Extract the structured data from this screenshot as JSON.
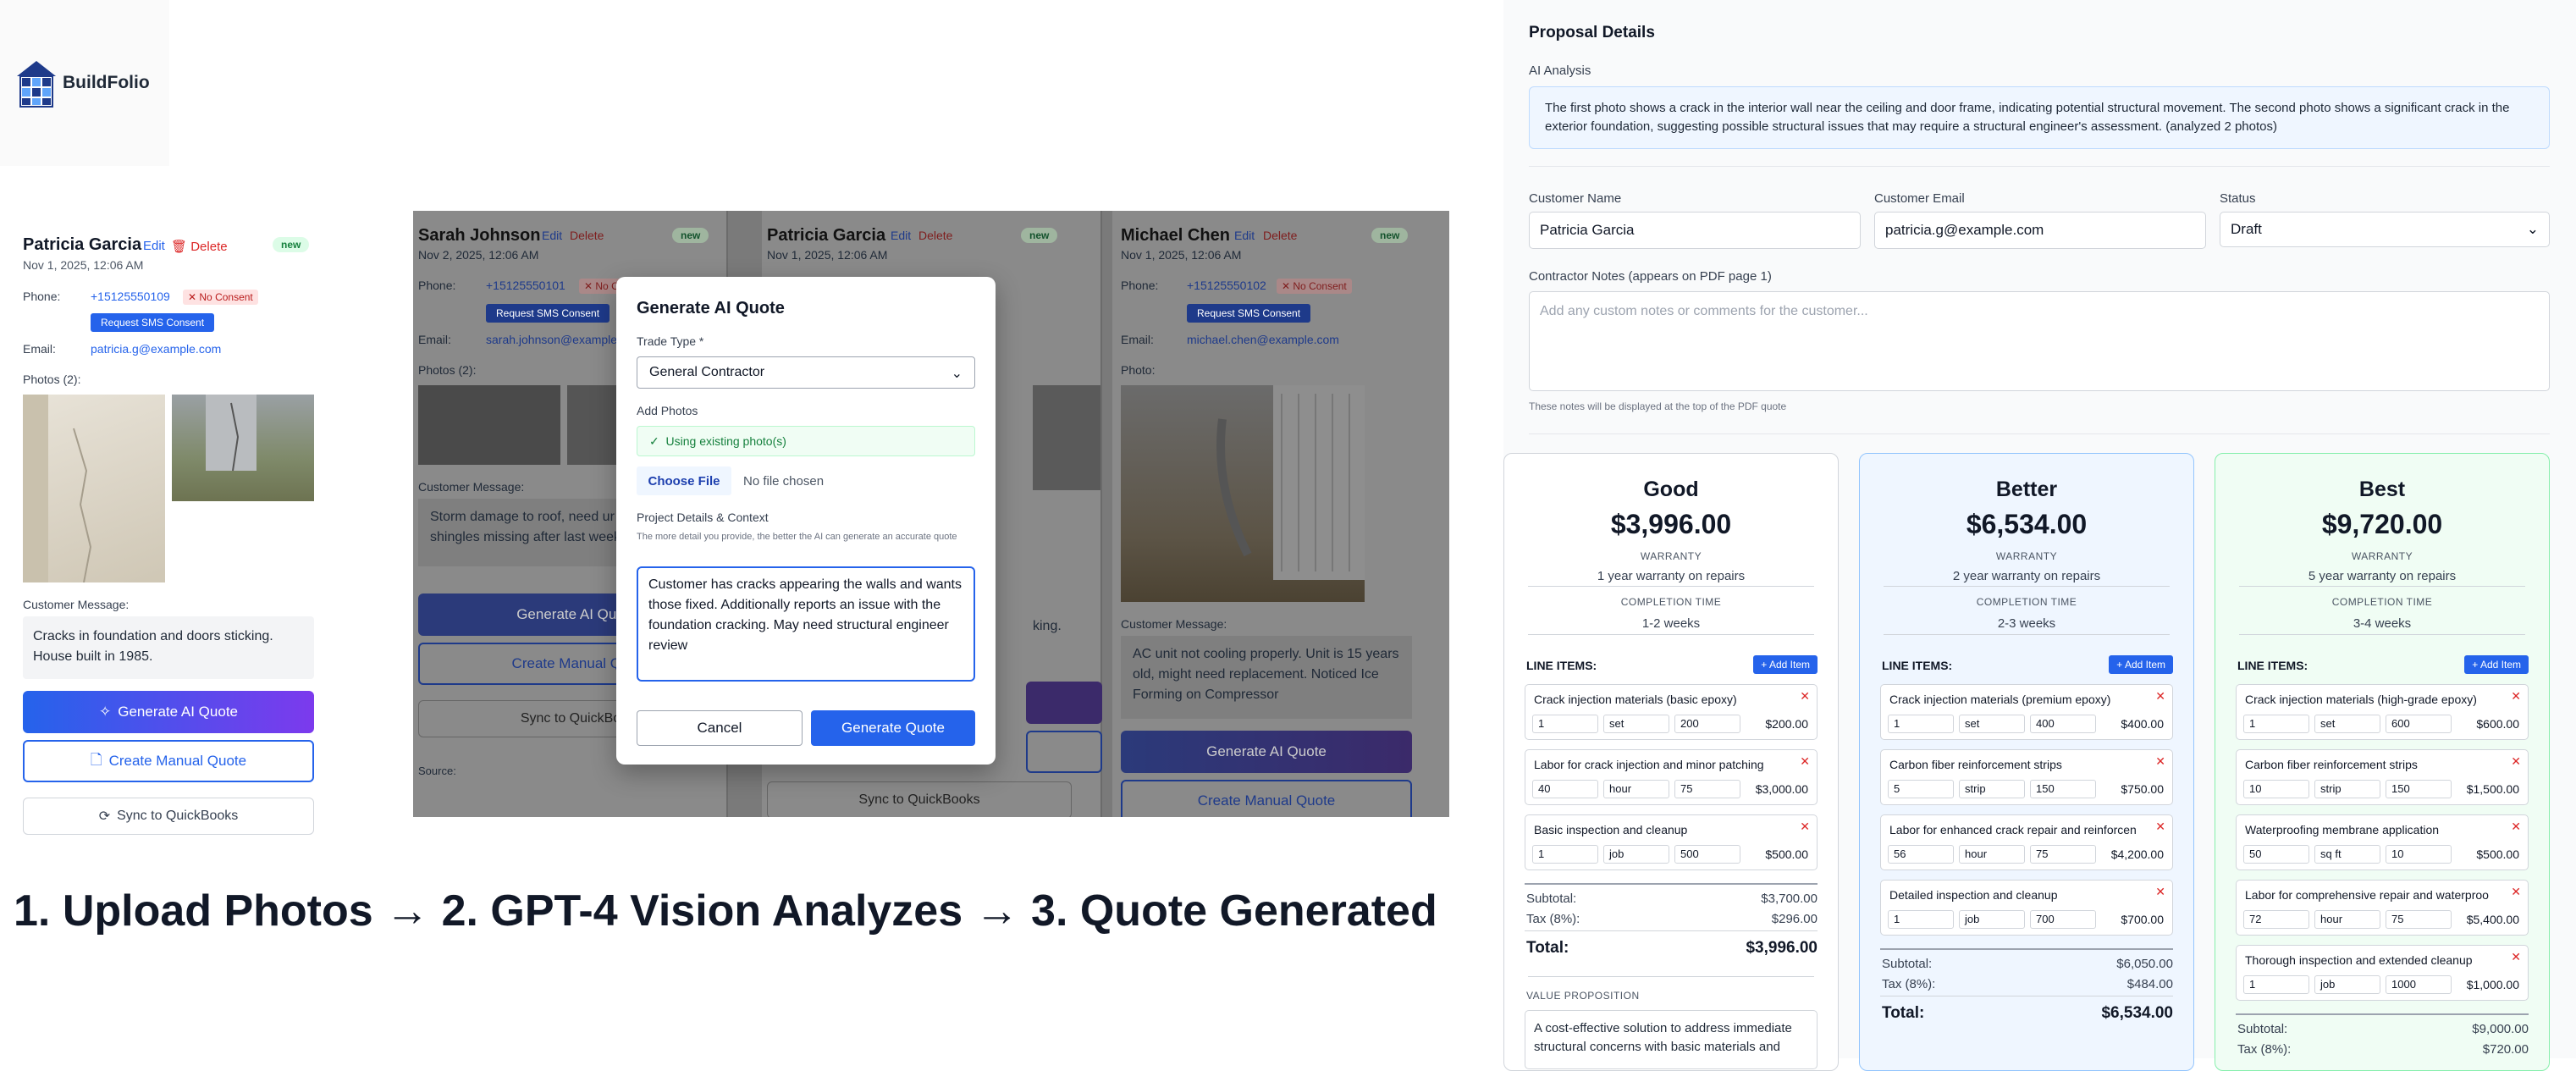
{
  "brand": {
    "name": "BuildFolio"
  },
  "caption": "1. Upload Photos → 2. GPT-4 Vision Analyzes → 3. Quote Generated",
  "lead_left": {
    "name": "Patricia Garcia",
    "edit": "Edit",
    "delete": "Delete",
    "badge": "new",
    "date": "Nov 1, 2025, 12:06 AM",
    "phone_label": "Phone:",
    "phone": "+15125550109",
    "no_consent": "✕ No Consent",
    "sms_button": "Request SMS Consent",
    "email_label": "Email:",
    "email": "patricia.g@example.com",
    "photos_label": "Photos (2):",
    "message_label": "Customer Message:",
    "message": "Cracks in foundation and doors sticking. House built in 1985.",
    "ai_button": "Generate AI Quote",
    "manual_button": "Create Manual Quote",
    "qb_button": "Sync to QuickBooks"
  },
  "bg_leads": [
    {
      "name": "Sarah Johnson",
      "edit": "Edit",
      "delete": "Delete",
      "badge": "new",
      "date": "Nov 2, 2025, 12:06 AM",
      "phone_label": "Phone:",
      "phone": "+15125550101",
      "no_consent": "✕ No C",
      "sms": "Request SMS Consent",
      "email_label": "Email:",
      "email": "sarah.johnson@example",
      "photos_label": "Photos (2):",
      "message_label": "Customer Message:",
      "message": "Storm damage to roof, need ur Multiple shingles missing after last week.",
      "ai": "Generate AI Quo",
      "manual": "Create Manual Qu",
      "qb": "Sync to QuickBo",
      "source": "Source:"
    },
    {
      "name": "Patricia Garcia",
      "edit": "Edit",
      "delete": "Delete",
      "badge": "new",
      "date": "Nov 1, 2025, 12:06 AM",
      "message_tail": "king.",
      "qb": "Sync to QuickBooks"
    },
    {
      "name": "Michael Chen",
      "edit": "Edit",
      "delete": "Delete",
      "badge": "new",
      "date": "Nov 1, 2025, 12:06 AM",
      "phone_label": "Phone:",
      "phone": "+15125550102",
      "no_consent": "✕ No Consent",
      "sms": "Request SMS Consent",
      "email_label": "Email:",
      "email": "michael.chen@example.com",
      "photo_label": "Photo:",
      "message_label": "Customer Message:",
      "message": "AC unit not cooling properly. Unit is 15 years old, might need replacement. Noticed Ice Forming on Compressor",
      "ai": "Generate AI Quote",
      "manual": "Create Manual Quote"
    }
  ],
  "modal": {
    "title": "Generate AI Quote",
    "trade_label": "Trade Type *",
    "trade_value": "General Contractor",
    "photos_label": "Add Photos",
    "photos_status": "Using existing photo(s)",
    "choose_file": "Choose File",
    "no_file": "No file chosen",
    "details_label": "Project Details & Context",
    "details_help": "The more detail you provide, the better the AI can generate an accurate quote",
    "details_value": "Customer has cracks appearing the walls and wants those fixed. Additionally reports an issue with the foundation cracking. May need structural engineer review",
    "cancel": "Cancel",
    "submit": "Generate Quote"
  },
  "proposal": {
    "title": "Proposal Details",
    "ai_label": "AI Analysis",
    "ai_text": "The first photo shows a crack in the interior wall near the ceiling and door frame, indicating potential structural movement. The second photo shows a significant crack in the exterior foundation, suggesting possible structural issues that may require a structural engineer's assessment. (analyzed 2 photos)",
    "customer_name_label": "Customer Name",
    "customer_name": "Patricia Garcia",
    "customer_email_label": "Customer Email",
    "customer_email": "patricia.g@example.com",
    "status_label": "Status",
    "status": "Draft",
    "notes_label": "Contractor Notes (appears on PDF page 1)",
    "notes_placeholder": "Add any custom notes or comments for the customer...",
    "notes_help": "These notes will be displayed at the top of the PDF quote"
  },
  "common": {
    "warranty": "WARRANTY",
    "completion": "COMPLETION TIME",
    "line_items": "LINE ITEMS:",
    "add_item": "+ Add Item",
    "subtotal": "Subtotal:",
    "tax": "Tax (8%):",
    "total": "Total:",
    "value_prop": "VALUE PROPOSITION"
  },
  "tiers": [
    {
      "name": "Good",
      "price": "$3,996.00",
      "warranty": "1 year warranty on repairs",
      "completion": "1-2 weeks",
      "items": [
        {
          "name": "Crack injection materials (basic epoxy)",
          "qty": "1",
          "unit": "set",
          "rate": "200",
          "amount": "$200.00"
        },
        {
          "name": "Labor for crack injection and minor patching",
          "qty": "40",
          "unit": "hour",
          "rate": "75",
          "amount": "$3,000.00"
        },
        {
          "name": "Basic inspection and cleanup",
          "qty": "1",
          "unit": "job",
          "rate": "500",
          "amount": "$500.00"
        }
      ],
      "subtotal": "$3,700.00",
      "tax": "$296.00",
      "total": "$3,996.00",
      "value_text": "A cost-effective solution to address immediate structural concerns with basic materials and"
    },
    {
      "name": "Better",
      "price": "$6,534.00",
      "warranty": "2 year warranty on repairs",
      "completion": "2-3 weeks",
      "items": [
        {
          "name": "Crack injection materials (premium epoxy)",
          "qty": "1",
          "unit": "set",
          "rate": "400",
          "amount": "$400.00"
        },
        {
          "name": "Carbon fiber reinforcement strips",
          "qty": "5",
          "unit": "strip",
          "rate": "150",
          "amount": "$750.00"
        },
        {
          "name": "Labor for enhanced crack repair and reinforcen",
          "qty": "56",
          "unit": "hour",
          "rate": "75",
          "amount": "$4,200.00"
        },
        {
          "name": "Detailed inspection and cleanup",
          "qty": "1",
          "unit": "job",
          "rate": "700",
          "amount": "$700.00"
        }
      ],
      "subtotal": "$6,050.00",
      "tax": "$484.00",
      "total": "$6,534.00"
    },
    {
      "name": "Best",
      "price": "$9,720.00",
      "warranty": "5 year warranty on repairs",
      "completion": "3-4 weeks",
      "items": [
        {
          "name": "Crack injection materials (high-grade epoxy)",
          "qty": "1",
          "unit": "set",
          "rate": "600",
          "amount": "$600.00"
        },
        {
          "name": "Carbon fiber reinforcement strips",
          "qty": "10",
          "unit": "strip",
          "rate": "150",
          "amount": "$1,500.00"
        },
        {
          "name": "Waterproofing membrane application",
          "qty": "50",
          "unit": "sq ft",
          "rate": "10",
          "amount": "$500.00"
        },
        {
          "name": "Labor for comprehensive repair and waterproo",
          "qty": "72",
          "unit": "hour",
          "rate": "75",
          "amount": "$5,400.00"
        },
        {
          "name": "Thorough inspection and extended cleanup",
          "qty": "1",
          "unit": "job",
          "rate": "1000",
          "amount": "$1,000.00"
        }
      ],
      "subtotal": "$9,000.00",
      "tax": "$720.00"
    }
  ]
}
